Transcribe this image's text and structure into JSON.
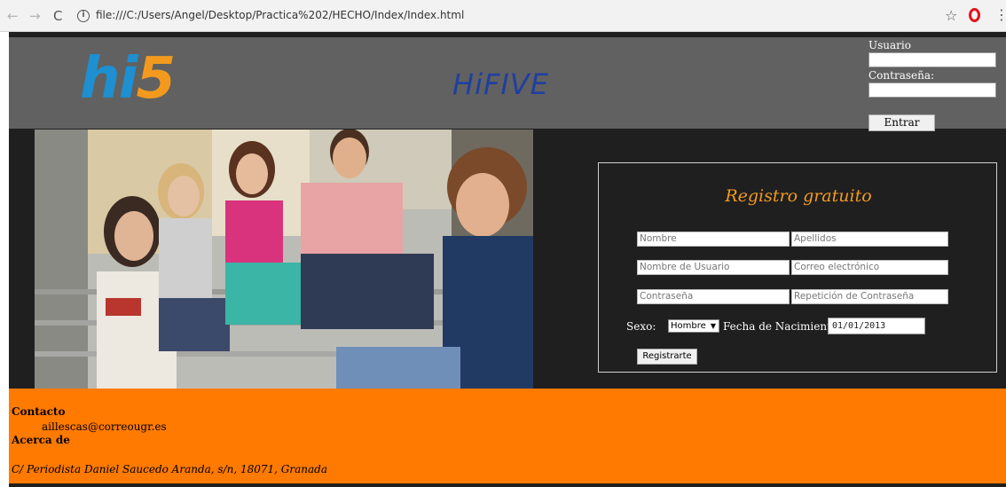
{
  "browser": {
    "url": "file:///C:/Users/Angel/Desktop/Practica%202/HECHO/Index/Index.html",
    "back_icon": "←",
    "forward_icon": "→",
    "reload_icon": "C",
    "info_icon": "i",
    "star_icon": "☆",
    "menu_icon": "⋮"
  },
  "header": {
    "logo_hi": "hi",
    "logo_5": "5",
    "title": "HiFIVE"
  },
  "login": {
    "user_label": "Usuario",
    "password_label": "Contraseña:",
    "enter_button": "Entrar"
  },
  "register": {
    "title": "Registro gratuito",
    "fields": {
      "nombre": "Nombre",
      "apellidos": "Apellidos",
      "usuario": "Nombre de Usuario",
      "correo": "Correo electrónico",
      "contrasena": "Contraseña",
      "repeticion": "Repetición de Contraseña"
    },
    "sexo_label": "Sexo:",
    "sexo_value": "Hombre",
    "sexo_arrow": "▼",
    "birth_label": "Fecha de Nacimiento:",
    "birth_value": "01/01/2013",
    "submit_button": "Registrarte"
  },
  "footer": {
    "contact_heading": "Contacto",
    "email": "aillescas@correougr.es",
    "about_heading": "Acerca de",
    "address": "C/ Periodista Daniel Saucedo Aranda, s/n, 18071, Granada"
  },
  "colors": {
    "accent_orange": "#ff7a00",
    "title_blue": "#1f3fa0",
    "logo_blue": "#1e8fd0",
    "logo_orange": "#f39a1e"
  }
}
